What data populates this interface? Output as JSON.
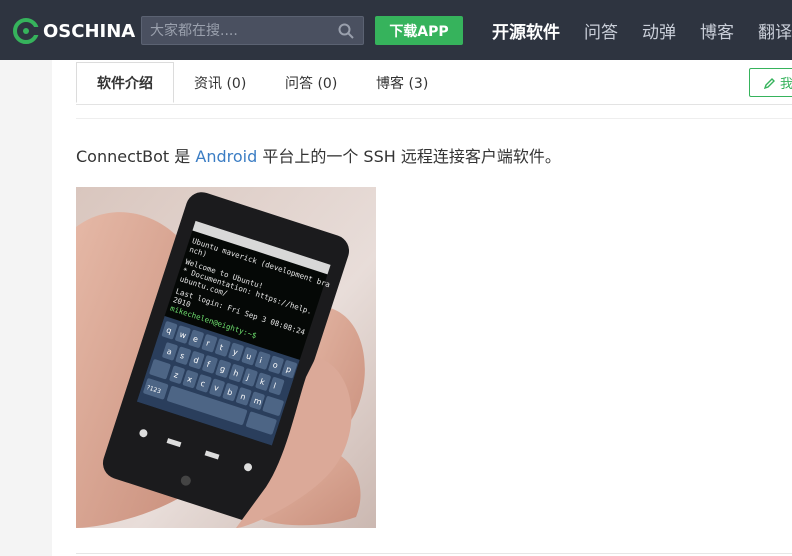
{
  "header": {
    "logo_text": "OSCHINA",
    "search_placeholder": "大家都在搜....",
    "download_label": "下载APP",
    "nav": [
      {
        "label": "开源软件",
        "active": true
      },
      {
        "label": "问答",
        "active": false
      },
      {
        "label": "动弹",
        "active": false
      },
      {
        "label": "博客",
        "active": false
      },
      {
        "label": "翻译",
        "active": false
      }
    ]
  },
  "tabs": [
    {
      "label": "软件介绍",
      "active": true
    },
    {
      "label": "资讯 (0)",
      "active": false
    },
    {
      "label": "问答 (0)",
      "active": false
    },
    {
      "label": "博客 (3)",
      "active": false
    }
  ],
  "write_label": "我",
  "content": {
    "intro_prefix": "ConnectBot 是 ",
    "intro_link": "Android",
    "intro_suffix": " 平台上的一个 SSH 远程连接客户端软件。"
  },
  "colors": {
    "topbar": "#2e3440",
    "accent_green": "#36b35c",
    "link_blue": "#3b7dc4"
  },
  "icons": {
    "search": "search-icon",
    "pencil": "pencil-icon",
    "logo": "oschina-logo-icon"
  }
}
